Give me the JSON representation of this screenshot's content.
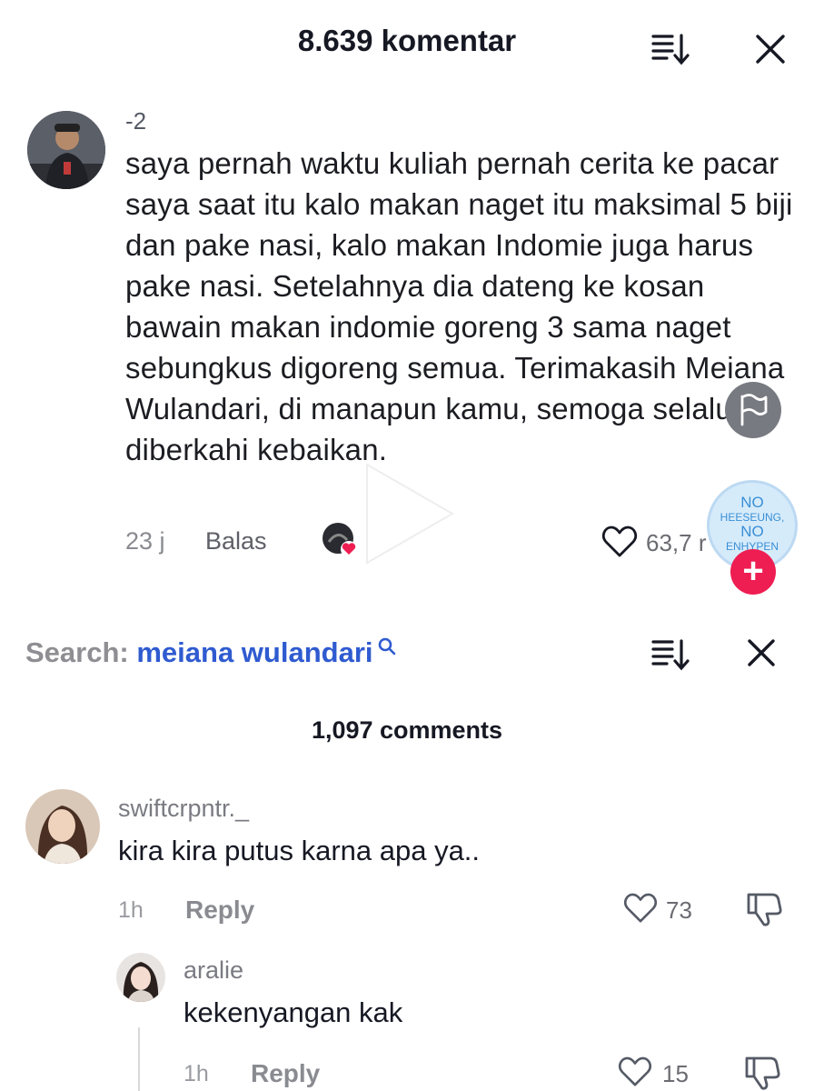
{
  "header": {
    "title": "8.639 komentar"
  },
  "top_comment": {
    "username": "-2",
    "text": "saya pernah waktu kuliah pernah cerita ke pacar saya saat itu kalo makan naget itu maksimal 5 biji dan pake nasi, kalo makan Indomie juga harus pake nasi. Setelahnya dia dateng ke kosan bawain makan indomie goreng 3 sama naget sebungkus digoreng semua. Terimakasih Meiana Wulandari, di manapun kamu, semoga selalu diberkahi kebaikan.",
    "time": "23 j",
    "reply_label": "Balas",
    "likes": "63,7 r"
  },
  "sticker": {
    "line1": "NO",
    "line2": "HEESEUNG,",
    "line3": "NO",
    "line4": "ENHYPEN"
  },
  "search": {
    "label": "Search:",
    "term": "meiana wulandari"
  },
  "comments_header": "1,097 comments",
  "comments": [
    {
      "username": "swiftcrpntr._",
      "text": "kira kira putus karna apa ya..",
      "time": "1h",
      "reply_label": "Reply",
      "likes": "73"
    },
    {
      "username": "aralie",
      "text": "kekenyangan kak",
      "time": "1h",
      "reply_label": "Reply",
      "likes": "15"
    }
  ],
  "icons": {
    "sort": "sort-icon",
    "close": "close-icon",
    "flag": "flag-icon",
    "heart": "heart-icon",
    "dislike": "dislike-icon",
    "search": "search-icon",
    "plus": "plus-icon"
  },
  "colors": {
    "accent_blue": "#2f5bd0",
    "plus_red": "#ee1d52",
    "like_heart": "#ee1d52"
  }
}
